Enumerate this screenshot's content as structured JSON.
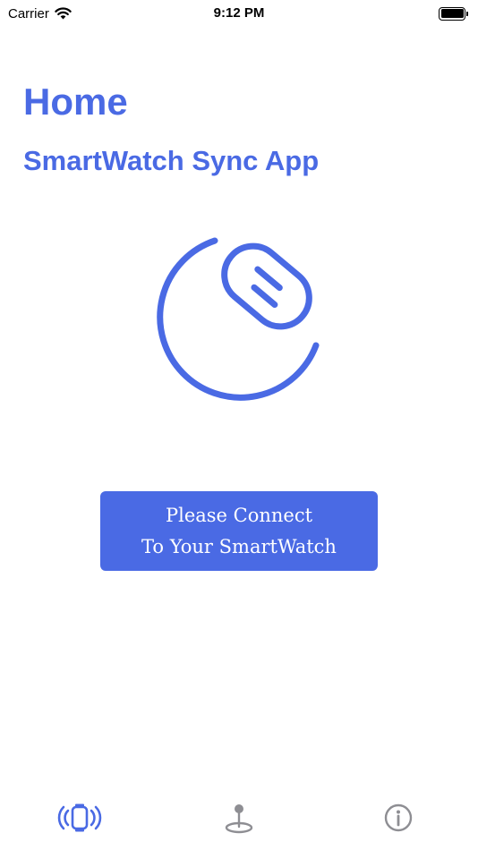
{
  "status_bar": {
    "carrier": "Carrier",
    "time": "9:12 PM"
  },
  "header": {
    "title": "Home",
    "subtitle": "SmartWatch Sync App"
  },
  "hero": {
    "icon": "smartwatch-connect-icon"
  },
  "connect": {
    "line1": "Please Connect",
    "line2": "To Your SmartWatch"
  },
  "tabs": [
    {
      "icon": "watch-sync-icon",
      "selected": true
    },
    {
      "icon": "location-pin-icon",
      "selected": false
    },
    {
      "icon": "info-icon",
      "selected": false
    }
  ],
  "colors": {
    "accent": "#4a6ae4",
    "tab_inactive": "#8e8e93",
    "background": "#ffffff"
  }
}
